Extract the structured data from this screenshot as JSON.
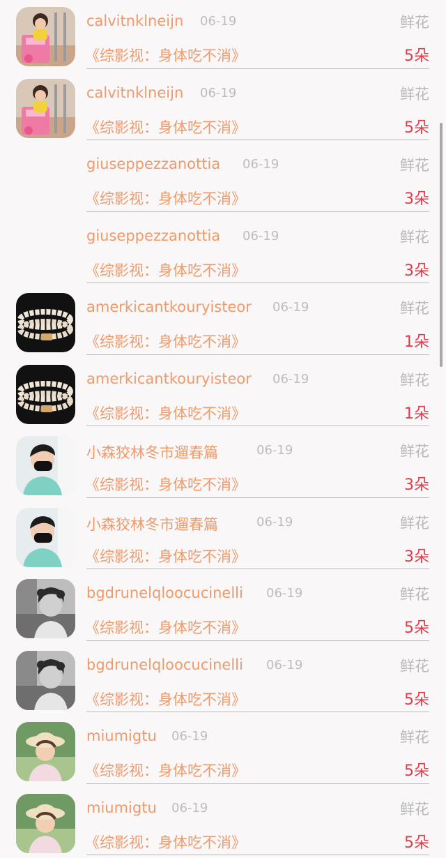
{
  "rows": [
    {
      "name": "calvitnklneijn",
      "date": "06-19",
      "gift": "鲜花",
      "title": "《综影视：身体吃不消》",
      "count": "5朵",
      "avatar": "girl-stroller"
    },
    {
      "name": "calvitnklneijn",
      "date": "06-19",
      "gift": "鲜花",
      "title": "《综影视：身体吃不消》",
      "count": "5朵",
      "avatar": "girl-stroller"
    },
    {
      "name": "giuseppezzanottia",
      "date": "06-19",
      "gift": "鲜花",
      "title": "《综影视：身体吃不消》",
      "count": "3朵",
      "avatar": "none"
    },
    {
      "name": "giuseppezzanottia",
      "date": "06-19",
      "gift": "鲜花",
      "title": "《综影视：身体吃不消》",
      "count": "3朵",
      "avatar": "none"
    },
    {
      "name": "amerkicantkouryisteor",
      "date": "06-19",
      "gift": "鲜花",
      "title": "《综影视：身体吃不消》",
      "count": "1朵",
      "avatar": "pearl-bracelet"
    },
    {
      "name": "amerkicantkouryisteor",
      "date": "06-19",
      "gift": "鲜花",
      "title": "《综影视：身体吃不消》",
      "count": "1朵",
      "avatar": "pearl-bracelet"
    },
    {
      "name": "小森狡林冬市遛春篇",
      "date": "06-19",
      "gift": "鲜花",
      "title": "《综影视：身体吃不消》",
      "count": "3朵",
      "avatar": "masked-man"
    },
    {
      "name": "小森狡林冬市遛春篇",
      "date": "06-19",
      "gift": "鲜花",
      "title": "《综影视：身体吃不消》",
      "count": "3朵",
      "avatar": "masked-man"
    },
    {
      "name": "bgdrunelqloocucinelli",
      "date": "06-19",
      "gift": "鲜花",
      "title": "《综影视：身体吃不消》",
      "count": "5朵",
      "avatar": "bw-girl"
    },
    {
      "name": "bgdrunelqloocucinelli",
      "date": "06-19",
      "gift": "鲜花",
      "title": "《综影视：身体吃不消》",
      "count": "5朵",
      "avatar": "bw-girl"
    },
    {
      "name": "miumigtu",
      "date": "06-19",
      "gift": "鲜花",
      "title": "《综影视：身体吃不消》",
      "count": "5朵",
      "avatar": "girl-hat"
    },
    {
      "name": "miumigtu",
      "date": "06-19",
      "gift": "鲜花",
      "title": "《综影视：身体吃不消》",
      "count": "5朵",
      "avatar": "girl-hat"
    }
  ]
}
